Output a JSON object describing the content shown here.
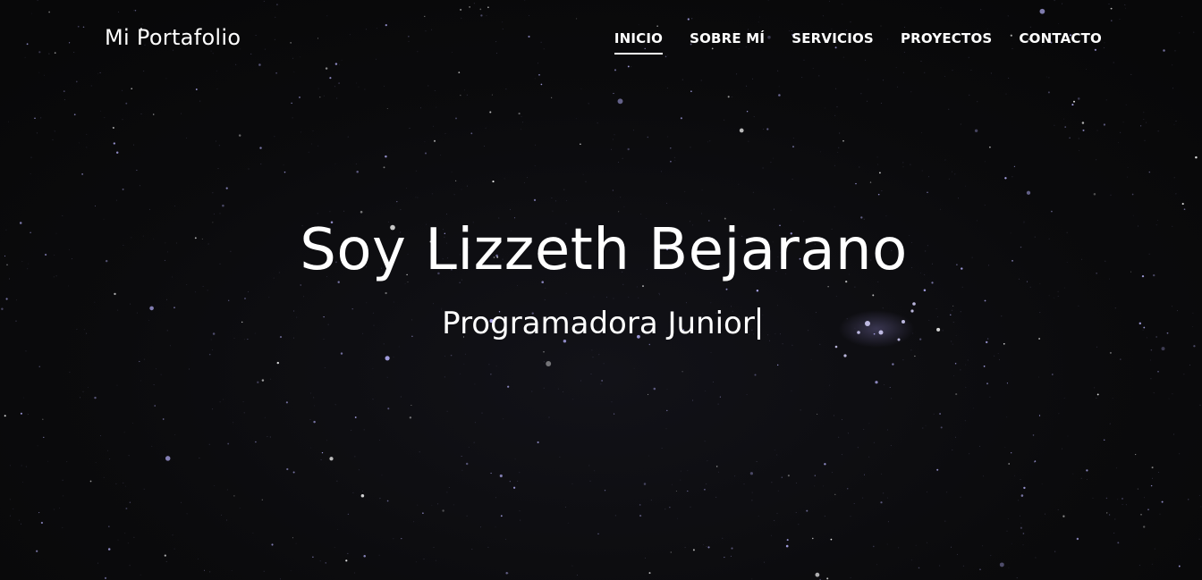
{
  "brand": {
    "name": "Mi Portafolio"
  },
  "nav": {
    "items": [
      {
        "label": "INICIO",
        "active": true
      },
      {
        "label": "SOBRE MÍ",
        "active": false
      },
      {
        "label": "SERVICIOS",
        "active": false
      },
      {
        "label": "PROYECTOS",
        "active": false
      },
      {
        "label": "CONTACTO",
        "active": false
      }
    ]
  },
  "hero": {
    "title": "Soy Lizzeth Bejarano",
    "subtitle": "Programadora Junior"
  },
  "colors": {
    "background": "#0a0a0c",
    "text": "#ffffff",
    "star": "#b9b4ff"
  }
}
